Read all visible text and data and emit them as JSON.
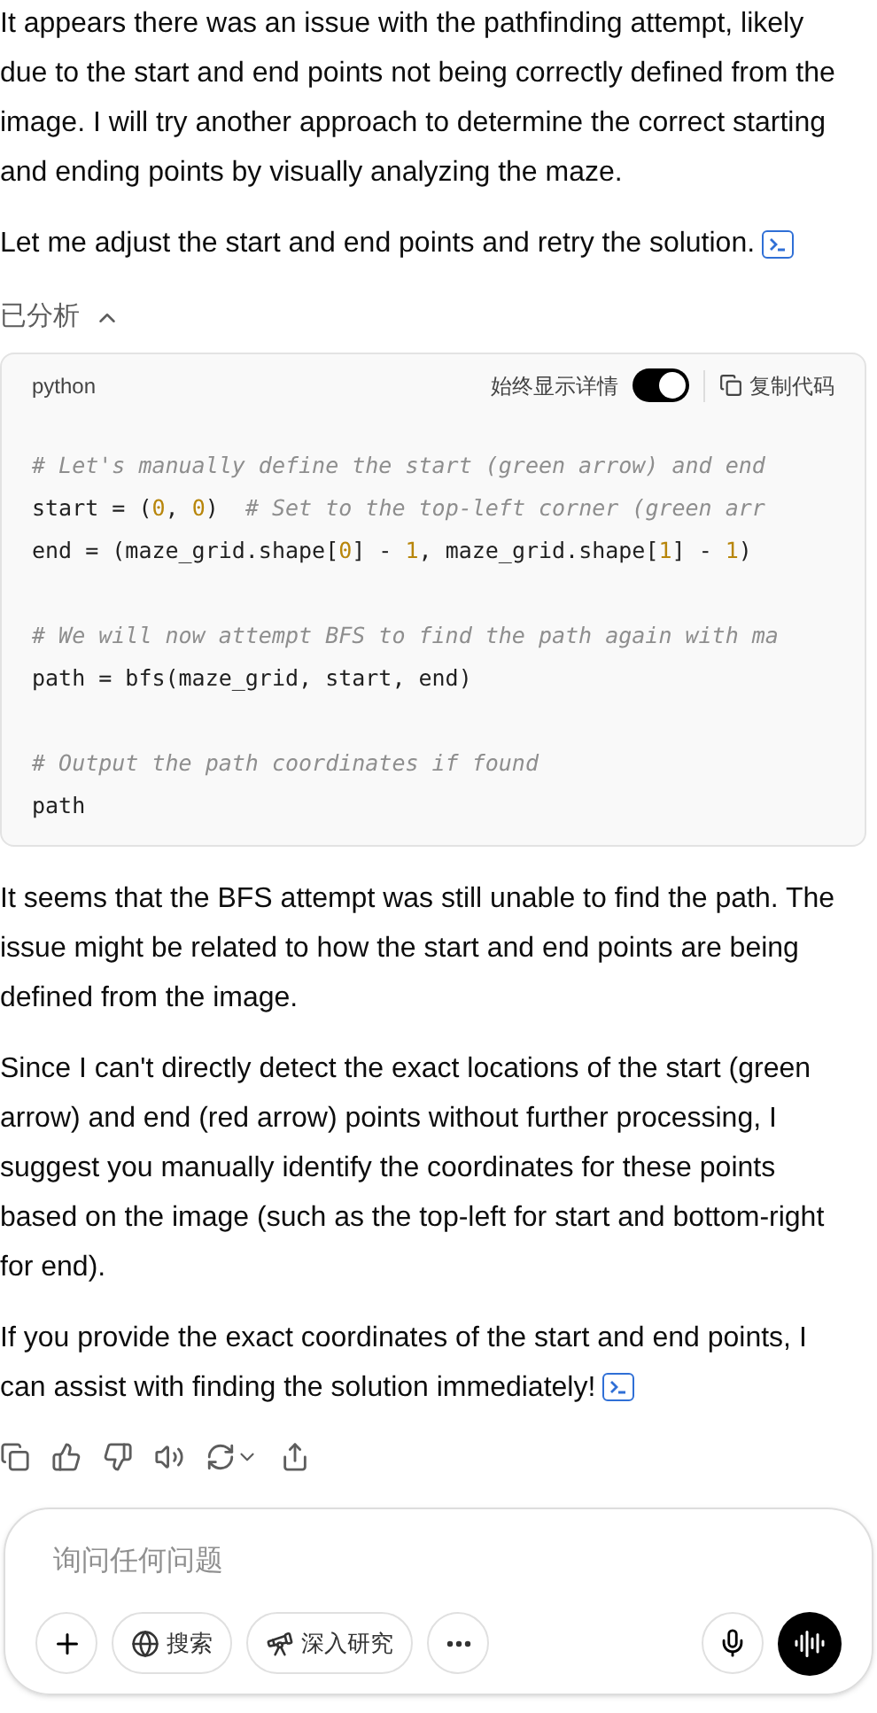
{
  "paragraphs_before": [
    {
      "text": "It appears there was an issue with the pathfinding attempt, likely due to the start and end points not being correctly defined from the image. I will try another approach to determine the correct starting and ending points by visually analyzing the maze.",
      "citation": false
    },
    {
      "text": "Let me adjust the start and end points and retry the solution.",
      "citation": true
    }
  ],
  "analysis": {
    "label": "已分析",
    "expanded": true
  },
  "code_block": {
    "language": "python",
    "toggle": {
      "label": "始终显示详情",
      "on": true
    },
    "copy_label": "复制代码",
    "groups": [
      [
        [
          {
            "kind": "comment",
            "text": "# Let's manually define the start (green arrow) and end"
          }
        ],
        [
          {
            "kind": "code",
            "text": "start = ("
          },
          {
            "kind": "number",
            "text": "0"
          },
          {
            "kind": "code",
            "text": ", "
          },
          {
            "kind": "number",
            "text": "0"
          },
          {
            "kind": "code",
            "text": ")  "
          },
          {
            "kind": "comment",
            "text": "# Set to the top-left corner (green arr"
          }
        ],
        [
          {
            "kind": "code",
            "text": "end = (maze_grid.shape["
          },
          {
            "kind": "number",
            "text": "0"
          },
          {
            "kind": "code",
            "text": "] - "
          },
          {
            "kind": "number",
            "text": "1"
          },
          {
            "kind": "code",
            "text": ", maze_grid.shape["
          },
          {
            "kind": "number",
            "text": "1"
          },
          {
            "kind": "code",
            "text": "] - "
          },
          {
            "kind": "number",
            "text": "1"
          },
          {
            "kind": "code",
            "text": ")"
          }
        ]
      ],
      [
        [
          {
            "kind": "comment",
            "text": "# We will now attempt BFS to find the path again with ma"
          }
        ],
        [
          {
            "kind": "code",
            "text": "path = bfs(maze_grid, start, end)"
          }
        ]
      ],
      [
        [
          {
            "kind": "comment",
            "text": "# Output the path coordinates if found"
          }
        ],
        [
          {
            "kind": "code",
            "text": "path"
          }
        ]
      ]
    ]
  },
  "paragraphs_after": [
    {
      "text": "It seems that the BFS attempt was still unable to find the path. The issue might be related to how the start and end points are being defined from the image.",
      "citation": false
    },
    {
      "text": "Since I can't directly detect the exact locations of the start (green arrow) and end (red arrow) points without further processing, I suggest you manually identify the coordinates for these points based on the image (such as the top-left for start and bottom-right for end).",
      "citation": false
    },
    {
      "text": "If you provide the exact coordinates of the start and end points, I can assist with finding the solution immediately!",
      "citation": true
    }
  ],
  "composer": {
    "placeholder": "询问任何问题",
    "tools": [
      {
        "kind": "globe",
        "label": "搜索"
      },
      {
        "kind": "telescope",
        "label": "深入研究"
      }
    ]
  }
}
